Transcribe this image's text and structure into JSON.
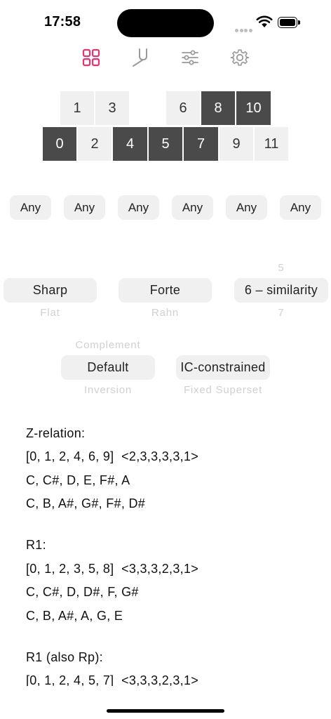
{
  "status_bar": {
    "time": "17:58"
  },
  "tab_bar": {
    "icons": [
      "grid-icon",
      "tuning-fork-icon",
      "sliders-icon",
      "gear-icon"
    ],
    "accent_color": "#e8336c",
    "inactive_color": "#9a9a9a"
  },
  "pitch_keys": {
    "top_row": [
      {
        "label": "1",
        "selected": false
      },
      {
        "label": "3",
        "selected": false
      },
      {
        "label": "6",
        "selected": false
      },
      {
        "label": "8",
        "selected": true
      },
      {
        "label": "10",
        "selected": true
      }
    ],
    "bottom_row": [
      {
        "label": "0",
        "selected": true
      },
      {
        "label": "2",
        "selected": false
      },
      {
        "label": "4",
        "selected": true
      },
      {
        "label": "5",
        "selected": true
      },
      {
        "label": "7",
        "selected": true
      },
      {
        "label": "9",
        "selected": false
      },
      {
        "label": "11",
        "selected": false
      }
    ]
  },
  "filters": {
    "any_labels": [
      "Any",
      "Any",
      "Any",
      "Any",
      "Any",
      "Any"
    ]
  },
  "pickers": {
    "spelling": {
      "selected": "Sharp",
      "below": "Flat"
    },
    "normal_form": {
      "selected": "Forte",
      "below": "Rahn"
    },
    "similarity": {
      "above": "5",
      "selected": "6 – similarity",
      "below": "7"
    },
    "mode": {
      "above": "Complement",
      "selected": "Default",
      "below": "Inversion"
    },
    "constraint": {
      "selected": "IC-constrained",
      "below": "Fixed Superset"
    }
  },
  "results": [
    "Z-relation:",
    "[0, 1, 2, 4, 6, 9]  <2,3,3,3,3,1>",
    "C, C#, D, E, F#, A",
    "C, B, A#, G#, F#, D#",
    "",
    "R1:",
    "[0, 1, 2, 3, 5, 8]  <3,3,3,2,3,1>",
    "C, C#, D, D#, F, G#",
    "C, B, A#, A, G, E",
    "",
    "R1 (also Rp):",
    "[0, 1, 2, 4, 5, 7]  <3,3,3,2,3,1>"
  ]
}
